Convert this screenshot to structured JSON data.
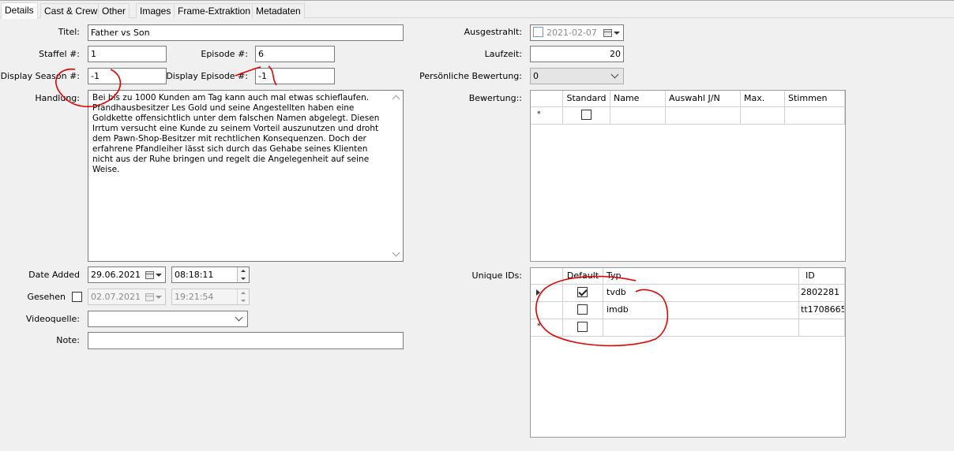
{
  "tabs": [
    {
      "label": "Details",
      "active": true
    },
    {
      "label": "Cast & Crew"
    },
    {
      "label": "Other"
    },
    {
      "label": "Images"
    },
    {
      "label": "Frame-Extraktion"
    },
    {
      "label": "Metadaten"
    }
  ],
  "left": {
    "title_label": "Titel:",
    "title_value": "Father vs  Son",
    "season_label": "Staffel #:",
    "season_value": "1",
    "episode_label": "Episode #:",
    "episode_value": "6",
    "display_season_label": "Display Season #:",
    "display_season_value": "-1",
    "display_episode_label": "Display Episode #:",
    "display_episode_value": "-1",
    "plot_label": "Handlung:",
    "plot_value": "Bei bis zu 1000 Kunden am Tag kann auch mal etwas schieflaufen. Pfandhausbesitzer Les Gold und seine Angestellten haben eine Goldkette offensichtlich unter dem falschen Namen abgelegt. Diesen Irrtum versucht eine Kunde zu seinem Vorteil auszunutzen und droht dem Pawn-Shop-Besitzer mit rechtlichen Konsequenzen. Doch der erfahrene Pfandleiher lässt sich durch das Gehabe seines Klienten nicht aus der Ruhe bringen und regelt die Angelegenheit auf seine Weise.",
    "date_added_label": "Date Added",
    "date_added_value": "29.06.2021",
    "time_added_value": "08:18:11",
    "watched_label": "Gesehen",
    "watched_date_value": "02.07.2021",
    "watched_time_value": "19:21:54",
    "video_source_label": "Videoquelle:",
    "video_source_value": "",
    "note_label": "Note:",
    "note_value": ""
  },
  "right": {
    "aired_label": "Ausgestrahlt:",
    "aired_value": "2021-02-07",
    "runtime_label": "Laufzeit:",
    "runtime_value": "20",
    "rating_user_label": "Persönliche Bewertung:",
    "rating_user_value": "0",
    "ratings_label": "Bewertung::",
    "ratings_columns": [
      "Standard",
      "Name",
      "Auswahl J/N",
      "Max.",
      "Stimmen"
    ],
    "new_row_marker": "*",
    "unique_ids_label": "Unique IDs:",
    "unique_ids_columns": [
      "Default",
      "Typ",
      "ID"
    ],
    "unique_ids_rows": [
      {
        "default": true,
        "type": "tvdb",
        "id": "2802281"
      },
      {
        "default": false,
        "type": "imdb",
        "id": "tt1708665"
      }
    ]
  },
  "colors": {
    "annotation": "#e00000",
    "background": "#f0f0f0"
  }
}
